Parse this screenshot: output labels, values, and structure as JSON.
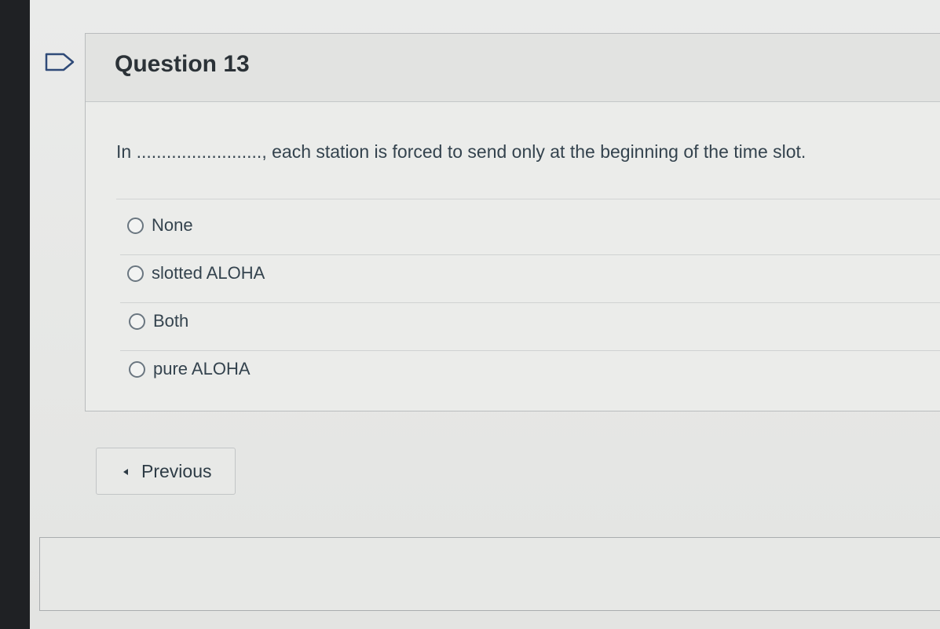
{
  "question": {
    "title": "Question 13",
    "text": "In ........................., each station is forced to send only at the beginning of the time slot.",
    "flag_icon": "flag-outline-icon"
  },
  "answers": [
    {
      "label": "None",
      "selected": false
    },
    {
      "label": "slotted ALOHA",
      "selected": false
    },
    {
      "label": "Both",
      "selected": false
    },
    {
      "label": "pure ALOHA",
      "selected": false
    }
  ],
  "navigation": {
    "previous_label": "Previous",
    "previous_icon": "chevron-left-icon"
  },
  "colors": {
    "text": "#2d3b45",
    "background": "#e6e7e5",
    "border": "#b9bcbd"
  }
}
